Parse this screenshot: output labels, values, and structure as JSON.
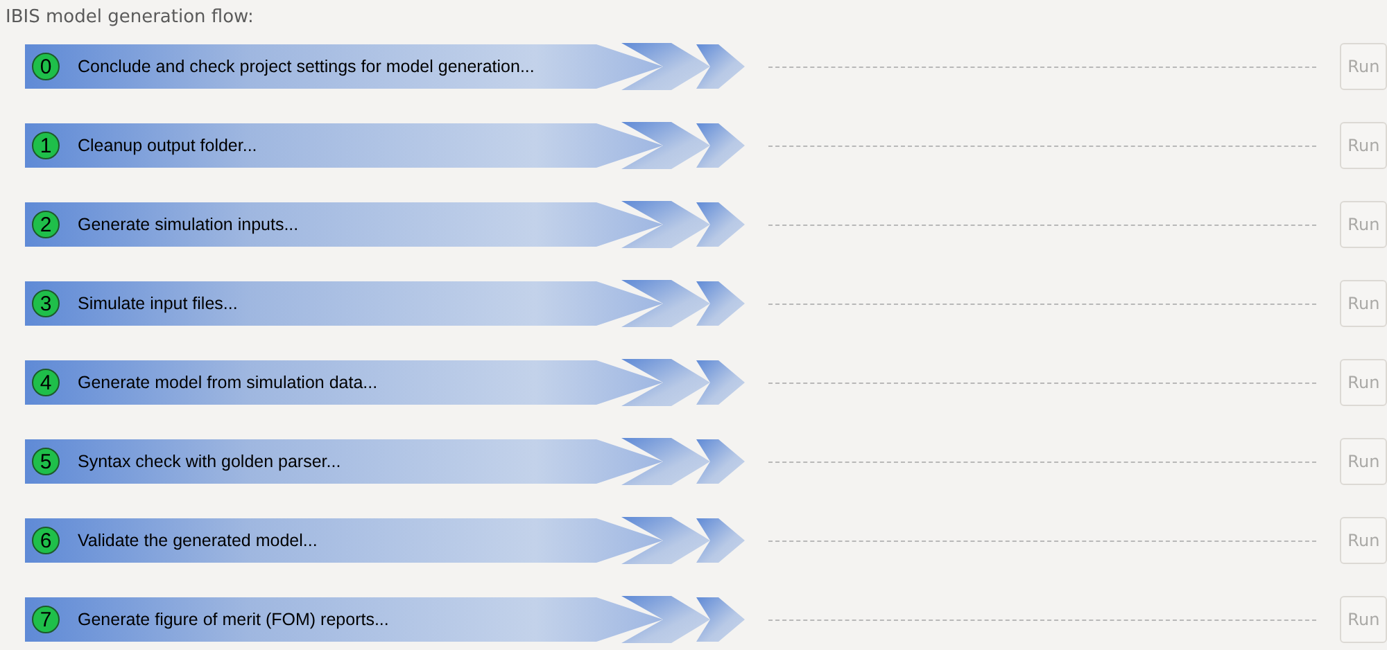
{
  "title": "IBIS model generation flow:",
  "steps": [
    {
      "number": "0",
      "label": "Conclude and check project settings for model generation...",
      "run": {
        "label": "Run",
        "disabled": true
      }
    },
    {
      "number": "1",
      "label": "Cleanup output folder...",
      "run": {
        "label": "Run",
        "disabled": true
      }
    },
    {
      "number": "2",
      "label": "Generate simulation inputs...",
      "run": {
        "label": "Run",
        "disabled": true
      }
    },
    {
      "number": "3",
      "label": "Simulate input files...",
      "run": {
        "label": "Run",
        "disabled": true
      }
    },
    {
      "number": "4",
      "label": "Generate model from simulation data...",
      "run": {
        "label": "Run",
        "disabled": true
      }
    },
    {
      "number": "5",
      "label": "Syntax check with golden parser...",
      "run": {
        "label": "Run",
        "disabled": true
      }
    },
    {
      "number": "6",
      "label": "Validate the generated model...",
      "run": {
        "label": "Run",
        "disabled": true
      }
    },
    {
      "number": "7",
      "label": "Generate figure of merit (FOM) reports...",
      "run": {
        "label": "Run",
        "disabled": true
      }
    }
  ]
}
